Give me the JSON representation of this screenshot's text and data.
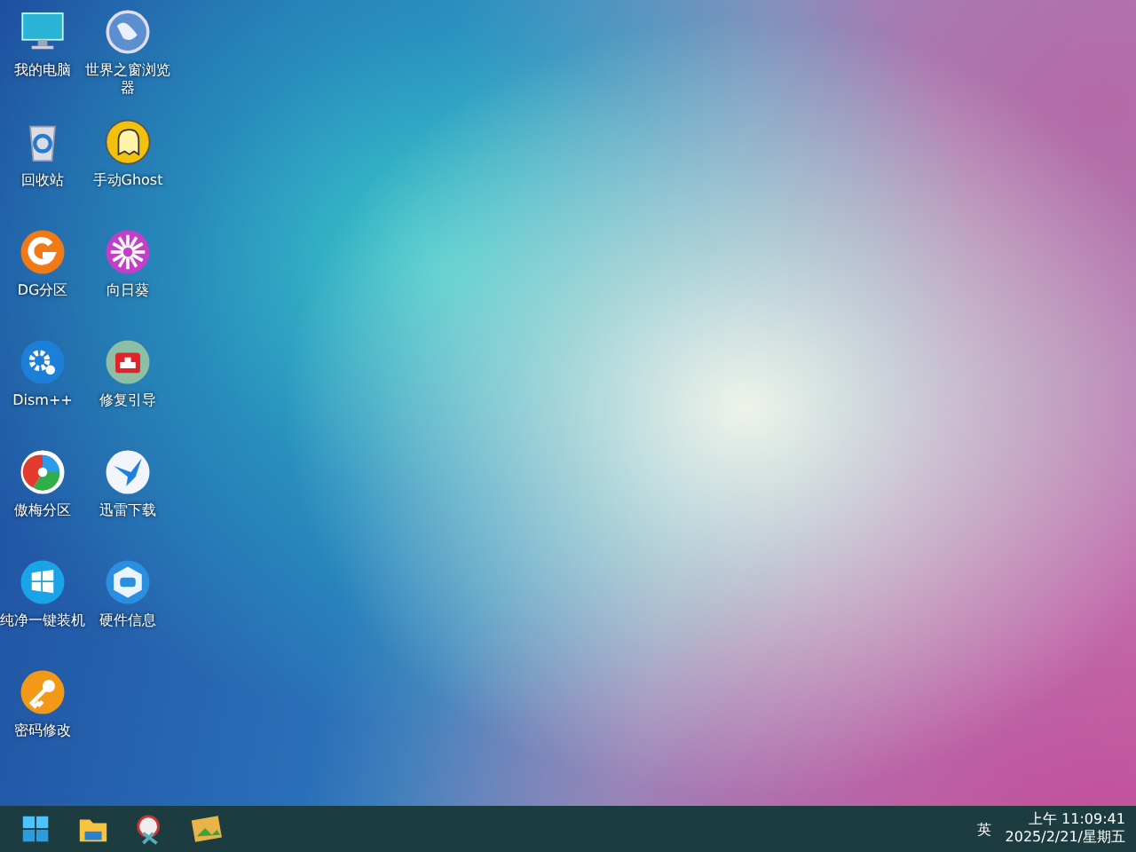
{
  "desktop_icons": [
    {
      "label": "我的电脑",
      "kind": "monitor"
    },
    {
      "label": "世界之窗浏览器",
      "kind": "globe"
    },
    {
      "label": "回收站",
      "kind": "recycle"
    },
    {
      "label": "手动Ghost",
      "kind": "ghost"
    },
    {
      "label": "DG分区",
      "kind": "dg"
    },
    {
      "label": "向日葵",
      "kind": "flower"
    },
    {
      "label": "Dism++",
      "kind": "gear"
    },
    {
      "label": "修复引导",
      "kind": "firstaid"
    },
    {
      "label": "傲梅分区",
      "kind": "pie"
    },
    {
      "label": "迅雷下载",
      "kind": "bird"
    },
    {
      "label": "纯净一键装机",
      "kind": "windows"
    },
    {
      "label": "硬件信息",
      "kind": "chip"
    },
    {
      "label": "密码修改",
      "kind": "key"
    }
  ],
  "taskbar": {
    "apps": [
      {
        "kind": "start"
      },
      {
        "kind": "folder"
      },
      {
        "kind": "tool"
      },
      {
        "kind": "picture"
      }
    ],
    "tray": {
      "language": "英",
      "time": "上午 11:09:41",
      "date": "2025/2/21/星期五"
    }
  }
}
